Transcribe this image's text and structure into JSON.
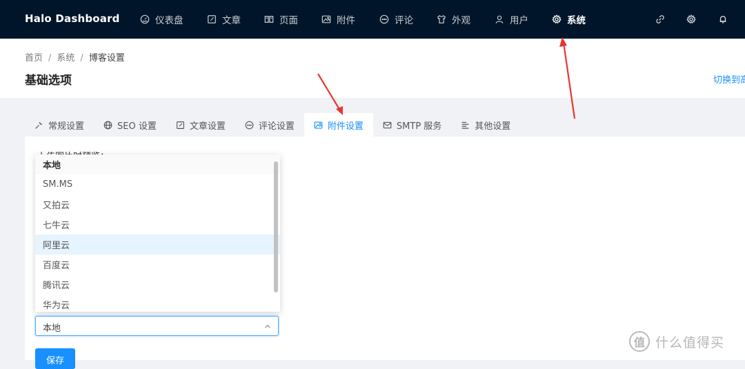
{
  "app": {
    "brand": "Halo  Dashboard"
  },
  "nav": {
    "items": [
      {
        "label": "仪表盘",
        "icon": "dashboard-icon"
      },
      {
        "label": "文章",
        "icon": "edit-icon"
      },
      {
        "label": "页面",
        "icon": "read-icon"
      },
      {
        "label": "附件",
        "icon": "picture-icon"
      },
      {
        "label": "评论",
        "icon": "message-icon"
      },
      {
        "label": "外观",
        "icon": "skin-icon"
      },
      {
        "label": "用户",
        "icon": "user-icon"
      },
      {
        "label": "系统",
        "icon": "setting-icon",
        "active": true
      }
    ],
    "right_icons": [
      "link-icon",
      "setting-icon",
      "bell-icon"
    ]
  },
  "breadcrumb": {
    "home": "首页",
    "system": "系统",
    "current": "博客设置"
  },
  "page": {
    "title": "基础选项",
    "switch_link": "切换到高"
  },
  "tabs": [
    {
      "label": "常规设置",
      "icon": "tool-icon"
    },
    {
      "label": "SEO 设置",
      "icon": "global-icon"
    },
    {
      "label": "文章设置",
      "icon": "form-icon"
    },
    {
      "label": "评论设置",
      "icon": "message-icon"
    },
    {
      "label": "附件设置",
      "icon": "picture-icon",
      "active": true
    },
    {
      "label": "SMTP 服务",
      "icon": "mail-icon"
    },
    {
      "label": "其他设置",
      "icon": "align-left-icon"
    }
  ],
  "form": {
    "field_label": "上传图片时预览：",
    "select_value": "本地",
    "options": [
      "本地",
      "SM.MS",
      "又拍云",
      "七牛云",
      "阿里云",
      "百度云",
      "腾讯云",
      "华为云"
    ],
    "selected_option": "本地",
    "hover_option": "阿里云",
    "save_label": "保存"
  },
  "watermark": {
    "text": "什么值得买",
    "logo": "值"
  },
  "colors": {
    "topbar": "#001529",
    "accent": "#1890ff",
    "arrow": "#e8362f"
  }
}
